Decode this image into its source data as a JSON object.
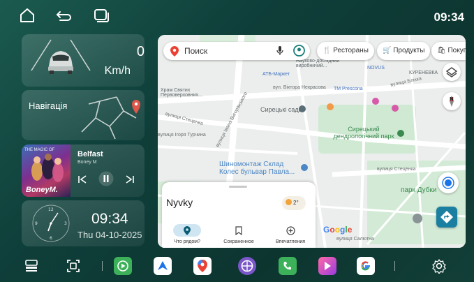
{
  "status": {
    "time": "09:34"
  },
  "speed": {
    "value": "0",
    "unit": "Km/h"
  },
  "navigation": {
    "title": "Навігація"
  },
  "media": {
    "song": "Belfast",
    "artist": "Boney M",
    "cover_caption": "THE MAGIC OF",
    "cover_brand": "BoneyM."
  },
  "clock_widget": {
    "time": "09:34",
    "date": "Thu  04-10-2025"
  },
  "map": {
    "search_placeholder": "Поиск",
    "chips": [
      "Рестораны",
      "Продукты",
      "Покупки"
    ],
    "labels": {
      "street1": "Храм Святих Первоверховних...",
      "market": "АТБ-Маркет",
      "street2": "вул. Віктора Некрасова",
      "prescona": "TM Prescona",
      "institute": "Науково-дослідний виробничий...",
      "novus": "NOVUS",
      "kurenevka": "КУРЕНЕВКА",
      "blikka": "вулиця Бліхка",
      "stecenka": "вулиця Стеценка",
      "vyshgorod": "вулиця Івана Вигорівського",
      "syrets": "Сирецькі сади",
      "park": "Сирецький дендрологічний парк",
      "turchina": "вулиця Ігоря Турчина",
      "tire": "Шиномонтаж Склад Колес бульвар Павла...",
      "stecenka2": "вулиця Стеценка",
      "park_dub": "парк Дубки",
      "salyutna": "вулиця Салютна",
      "google": "Google"
    },
    "panel": {
      "place": "Nyvky",
      "weather": "2°",
      "tabs": [
        "Что рядом?",
        "Сохраненное",
        "Впечатления"
      ]
    }
  },
  "colors": {
    "accent": "#1a7fa0",
    "bg": "#0f3f3a"
  }
}
